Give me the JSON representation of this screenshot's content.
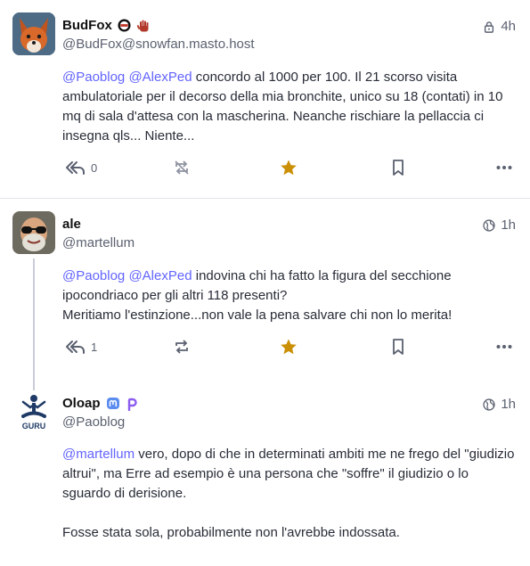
{
  "colors": {
    "accent": "#6364ff",
    "favourite": "#ca8f04",
    "muted": "#5b6170",
    "divider": "#e4e6ec"
  },
  "posts": [
    {
      "display_name": "BudFox",
      "handle": "@BudFox@snowfan.masto.host",
      "time": "4h",
      "visibility_icon": "lock-icon",
      "mentions": [
        "@Paoblog",
        "@AlexPed"
      ],
      "text": " concordo al 1000 per 100. Il 21 scorso visita ambulatoriale per il decorso della mia bronchite, unico su 18 (contati) in 10 mq di sala d'attesa con la mascherina. Neanche rischiare la pellaccia ci insegna qls... Niente...",
      "reply_count": "0",
      "favourited": true
    },
    {
      "display_name": "ale",
      "handle": "@martellum",
      "time": "1h",
      "visibility_icon": "globe-icon",
      "mentions": [
        "@Paoblog",
        "@AlexPed"
      ],
      "text": " indovina chi ha fatto la figura del secchione ipocondriaco per gli altri 118 presenti?",
      "text2": "Meritiamo l'estinzione...non vale la pena salvare chi non lo merita!",
      "reply_count": "1",
      "favourited": true
    },
    {
      "display_name": "Oloap",
      "handle": "@Paoblog",
      "time": "1h",
      "visibility_icon": "globe-icon",
      "avatar_label": "GURU",
      "mentions": [
        "@martellum"
      ],
      "text": " vero, dopo di che in determinati ambiti me ne frego del \"giudizio altrui\", ma Erre ad esempio è una persona che \"soffre\" il giudizio o lo sguardo di derisione.",
      "text2": "Fosse stata sola, probabilmente non l'avrebbe indossata."
    }
  ]
}
